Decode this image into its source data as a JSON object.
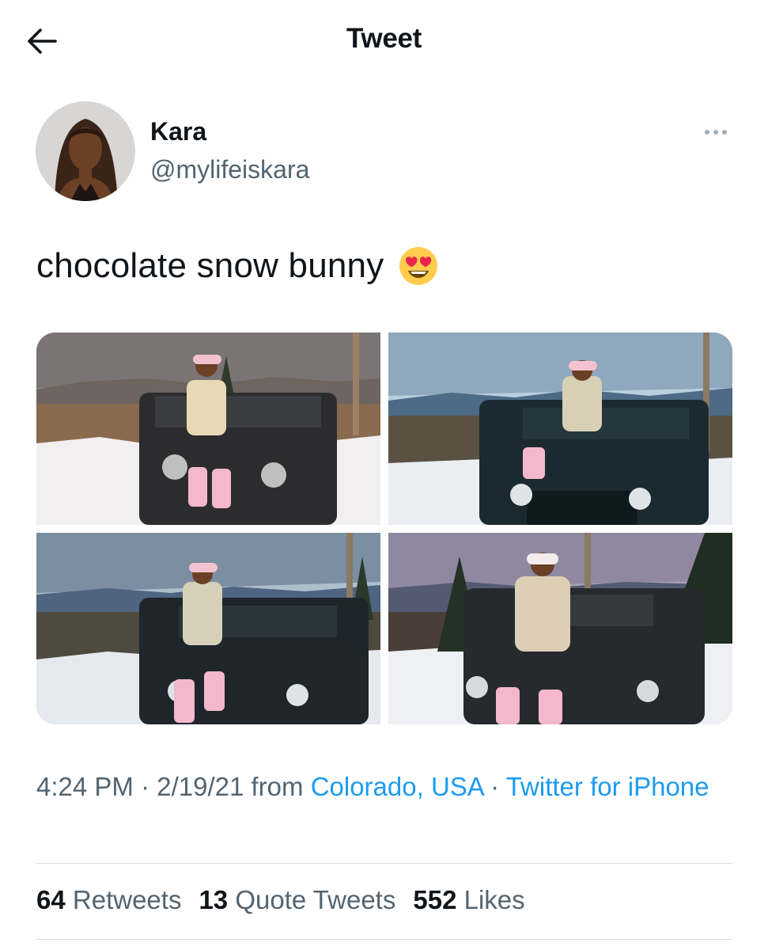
{
  "header": {
    "title": "Tweet",
    "back_icon": "arrow-left-icon"
  },
  "author": {
    "name": "Kara",
    "handle": "@mylifeiskara",
    "more_icon": "more-horizontal-icon"
  },
  "tweet": {
    "text": "chocolate snow bunny",
    "emoji": "heart-eyes-emoji",
    "media_count": 4
  },
  "meta": {
    "time": "4:24 PM",
    "sep1": " · ",
    "date": "2/19/21",
    "from": " from ",
    "location": "Colorado, USA",
    "sep2": " · ",
    "source": "Twitter for iPhone"
  },
  "stats": {
    "retweets_count": "64",
    "retweets_label": "Retweets",
    "quotes_count": "13",
    "quotes_label": "Quote Tweets",
    "likes_count": "552",
    "likes_label": "Likes"
  },
  "colors": {
    "link": "#1d9bf0",
    "secondary_text": "#536471",
    "primary_text": "#0f1419"
  }
}
